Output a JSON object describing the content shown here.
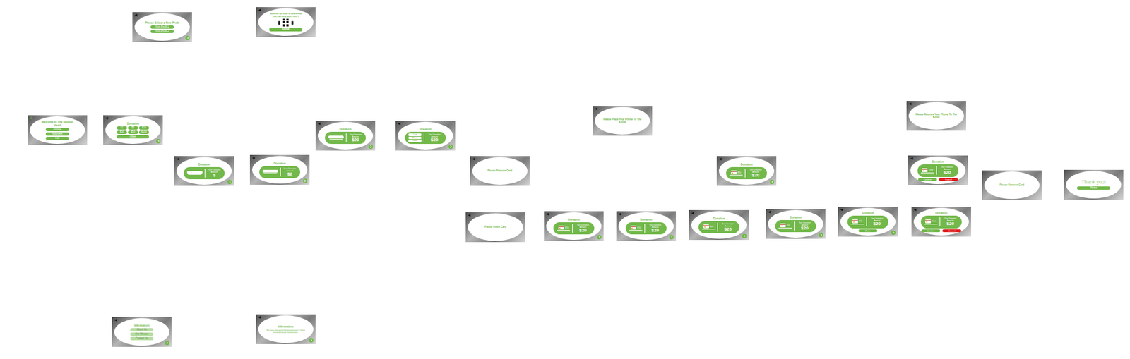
{
  "screens": [
    {
      "kind": "menu",
      "menu_icon": "☰",
      "title": "Welcome to The Helping Hand",
      "buttons": [
        "Donate",
        "Volunteer",
        "Info"
      ],
      "faded": false,
      "nav": false
    },
    {
      "kind": "menu",
      "back": "◀",
      "title": "Please Select a Non-Profit",
      "buttons": [
        "Non-Profit 1",
        "Non-Profit 2"
      ],
      "faded": false,
      "nav": true
    },
    {
      "kind": "qr",
      "back": "◀",
      "title": "Scan the QR code to Learn How You Can Help Non-Profit 1",
      "button": "Home",
      "nav": false
    },
    {
      "kind": "amounts",
      "back": "◀",
      "title": "Donation",
      "buttons": [
        "$1",
        "$5",
        "$10",
        "$20",
        "$50",
        "$100"
      ],
      "wide": "Other",
      "nav": true
    },
    {
      "kind": "menu",
      "back": "◀",
      "title": "Information",
      "buttons": [
        "About Us",
        "Our Mission",
        "Contact Us"
      ],
      "faded": true,
      "nav": true
    },
    {
      "kind": "text",
      "back": "◀",
      "title": "Information",
      "body": "We are a non-profit that provides aid to those in need in local communities.",
      "nav": true
    },
    {
      "kind": "entry",
      "back": "◀",
      "title": "Donation",
      "label": "Your Donation Amount",
      "amount": "$",
      "nav": true
    },
    {
      "kind": "entry",
      "back": "◀",
      "title": "Donation",
      "label": "Your Donation Amount",
      "amount": "$2",
      "nav": true
    },
    {
      "kind": "entry",
      "back": "◀",
      "title": "Donation",
      "label": "Your Donation Amount",
      "amount": "$20",
      "nav": true
    },
    {
      "kind": "options",
      "back": "◀",
      "title": "Donation",
      "options": [
        "Card",
        "Phone",
        "Cash"
      ],
      "label": "Your Donation Amount",
      "amount": "$20",
      "nav": true
    },
    {
      "kind": "message",
      "back": "◀",
      "text": "Please Remove Card",
      "nav": false
    },
    {
      "kind": "message",
      "back": "◀",
      "text": "Please Insert Card",
      "nav": false
    },
    {
      "kind": "message",
      "back": "◀",
      "text": "Please Place Your Phone To The Kiosk",
      "nav": false
    },
    {
      "kind": "card",
      "back": "◀",
      "title": "Donation",
      "card_label": "$20",
      "label": "Your Donation Amount",
      "amount": "$20",
      "buttons": [],
      "nav": true
    },
    {
      "kind": "card",
      "back": "◀",
      "title": "Donation",
      "card_label": "$20",
      "label": "Your Donation Amount",
      "amount": "$20",
      "buttons": [],
      "nav": true
    },
    {
      "kind": "card",
      "back": "◀",
      "title": "Donation",
      "card_label": "$20",
      "label": "Your Donation Amount",
      "amount": "$20",
      "buttons": [],
      "nav": true
    },
    {
      "kind": "card",
      "back": "◀",
      "title": "Donation",
      "card_label": "$20",
      "label": "Your Donation Amount",
      "amount": "$20",
      "buttons": [],
      "nav": true
    },
    {
      "kind": "card",
      "back": "◀",
      "title": "Donation",
      "card_label": "$20",
      "label": "Your Donation Amount",
      "amount": "$20",
      "buttons": [
        {
          "label": "Enter",
          "color": "#72b84a"
        }
      ],
      "nav": true
    },
    {
      "kind": "card",
      "back": "◀",
      "title": "Donation",
      "card_label": "Card",
      "label": "Your Donation Amount",
      "amount": "$20",
      "buttons": [
        {
          "label": "Confirm",
          "color": "#72b84a"
        },
        {
          "label": "Cancel",
          "color": "#e02020"
        }
      ],
      "nav": false
    },
    {
      "kind": "card",
      "back": "◀",
      "title": "Donation",
      "card_label": "$20",
      "label": "Your Donation Amount",
      "amount": "$20",
      "buttons": [],
      "nav": true
    },
    {
      "kind": "message",
      "back": "◀",
      "text": "Please Remove Your Phone To The Kiosk",
      "nav": false
    },
    {
      "kind": "card",
      "back": "◀",
      "title": "Donation",
      "card_label": "Card",
      "label": "Your Donation Amount",
      "amount": "$20",
      "buttons": [
        {
          "label": "Confirm",
          "color": "#72b84a"
        },
        {
          "label": "Cancel",
          "color": "#e02020"
        }
      ],
      "nav": false
    },
    {
      "kind": "message",
      "text": "Please Remove Card",
      "nav": false
    },
    {
      "kind": "thanks",
      "title": "Thank you!",
      "button": "Home",
      "nav": false
    }
  ]
}
